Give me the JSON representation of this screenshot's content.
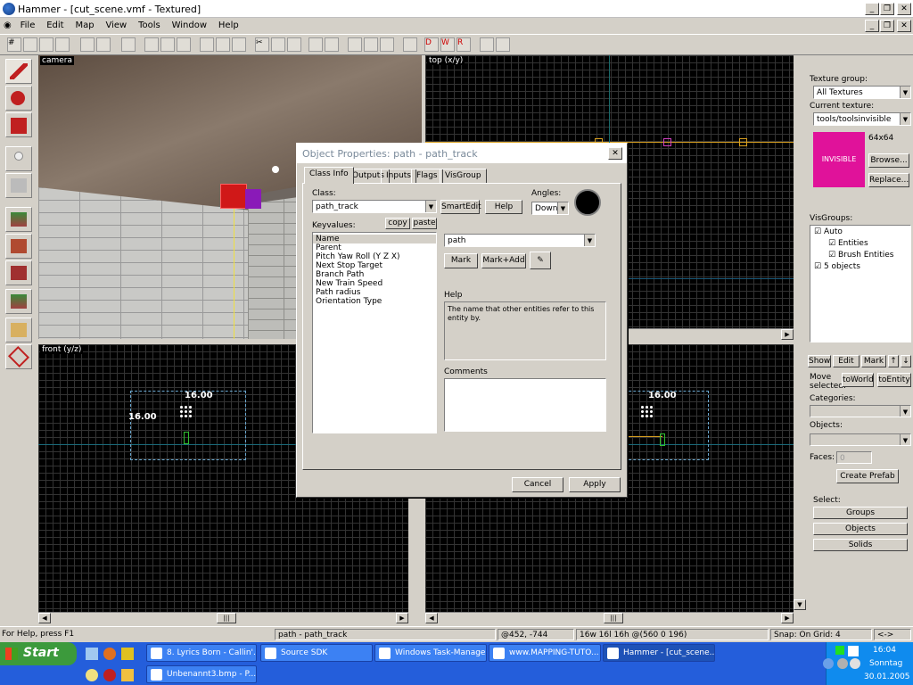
{
  "window": {
    "title": "Hammer - [cut_scene.vmf - Textured]"
  },
  "menu": [
    "File",
    "Edit",
    "Map",
    "View",
    "Tools",
    "Window",
    "Help"
  ],
  "viewports": {
    "camera": "camera",
    "top": "top (x/y)",
    "front": "front (y/z)"
  },
  "front_dims": {
    "width": "16.00",
    "height": "16.00"
  },
  "side_dims": {
    "width": "16.00"
  },
  "dialog": {
    "title": "Object Properties: path - path_track",
    "tabs": [
      "Class Info",
      "Outputs",
      "Inputs",
      "Flags",
      "VisGroup"
    ],
    "class_label": "Class:",
    "class_value": "path_track",
    "smartedit": "SmartEdit",
    "help_btn": "Help",
    "angles_label": "Angles:",
    "angles_value": "Down",
    "keyvalues_label": "Keyvalues:",
    "copy": "copy",
    "paste": "paste",
    "keyvalues": [
      "Name",
      "Parent",
      "Pitch Yaw Roll (Y Z X)",
      "Next Stop Target",
      "Branch Path",
      "New Train Speed",
      "Path radius",
      "Orientation Type"
    ],
    "value": "path",
    "mark": "Mark",
    "mark_add": "Mark+Add",
    "help_label": "Help",
    "help_text": "The name that other entities refer to this entity by.",
    "comments_label": "Comments",
    "cancel": "Cancel",
    "apply": "Apply"
  },
  "right_panel": {
    "texture_group_label": "Texture group:",
    "texture_group": "All Textures",
    "current_texture_label": "Current texture:",
    "current_texture": "tools/toolsinvisible",
    "texture_size": "64x64",
    "texture_preview_text": "INVISIBLE",
    "texture_color": "#e0129a",
    "browse": "Browse...",
    "replace": "Replace...",
    "visgroups_label": "VisGroups:",
    "visgroups": [
      {
        "label": "Auto",
        "indent": 0
      },
      {
        "label": "Entities",
        "indent": 1
      },
      {
        "label": "Brush Entities",
        "indent": 1
      },
      {
        "label": "5 objects",
        "indent": 0
      }
    ],
    "show": "Show",
    "edit": "Edit",
    "mark": "Mark",
    "move_selected": "Move selected:",
    "to_world": "toWorld",
    "to_entity": "toEntity",
    "categories_label": "Categories:",
    "objects_label": "Objects:",
    "faces_label": "Faces:",
    "faces_value": "0",
    "create_prefab": "Create Prefab",
    "select_label": "Select:",
    "groups": "Groups",
    "objects": "Objects",
    "solids": "Solids"
  },
  "status": {
    "help": "For Help, press F1",
    "selection": "path - path_track",
    "coords": "@452, -744",
    "dims": "16w 16l 16h @(560 0 196)",
    "snap": "Snap: On Grid: 4",
    "arrows": "<->"
  },
  "taskbar": {
    "start": "Start",
    "tasks": [
      "8. Lyrics Born - Callin'...",
      "Source SDK",
      "Windows Task-Manager",
      "www.MAPPING-TUTO...",
      "Hammer - [cut_scene...",
      "Unbenannt3.bmp - P..."
    ],
    "time": "16:04",
    "day": "Sonntag",
    "date": "30.01.2005"
  }
}
